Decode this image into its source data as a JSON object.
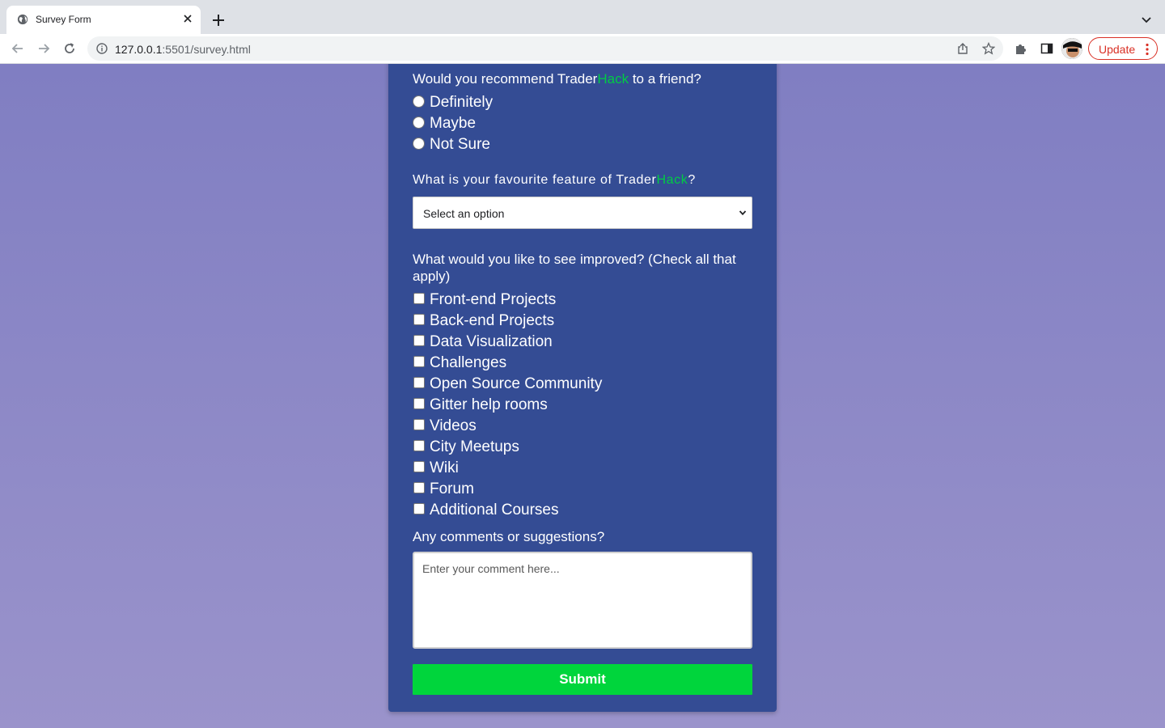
{
  "browser": {
    "tab_title": "Survey Form",
    "url_host": "127.0.0.1",
    "url_rest": ":5501/survey.html",
    "update_label": "Update"
  },
  "form": {
    "recommend": {
      "question_prefix": "Would you recommend Trader",
      "question_brand": "Hack",
      "question_suffix": " to a friend?",
      "options": [
        "Definitely",
        "Maybe",
        "Not Sure"
      ]
    },
    "feature": {
      "question_prefix": "What is your favourite feature of Trader",
      "question_brand": "Hack",
      "question_suffix": "?",
      "selected": "Select an option"
    },
    "improve": {
      "question": "What would you like to see improved? (Check all that apply)",
      "options": [
        "Front-end Projects",
        "Back-end Projects",
        "Data Visualization",
        "Challenges",
        "Open Source Community",
        "Gitter help rooms",
        "Videos",
        "City Meetups",
        "Wiki",
        "Forum",
        "Additional Courses"
      ]
    },
    "comments": {
      "question": "Any comments or suggestions?",
      "placeholder": "Enter your comment here..."
    },
    "submit_label": "Submit"
  },
  "colors": {
    "card": "#344c94",
    "brand_accent": "#00cc44",
    "submit": "#00d53c",
    "background_top": "#807ec2",
    "background_bottom": "#9a93cb"
  }
}
